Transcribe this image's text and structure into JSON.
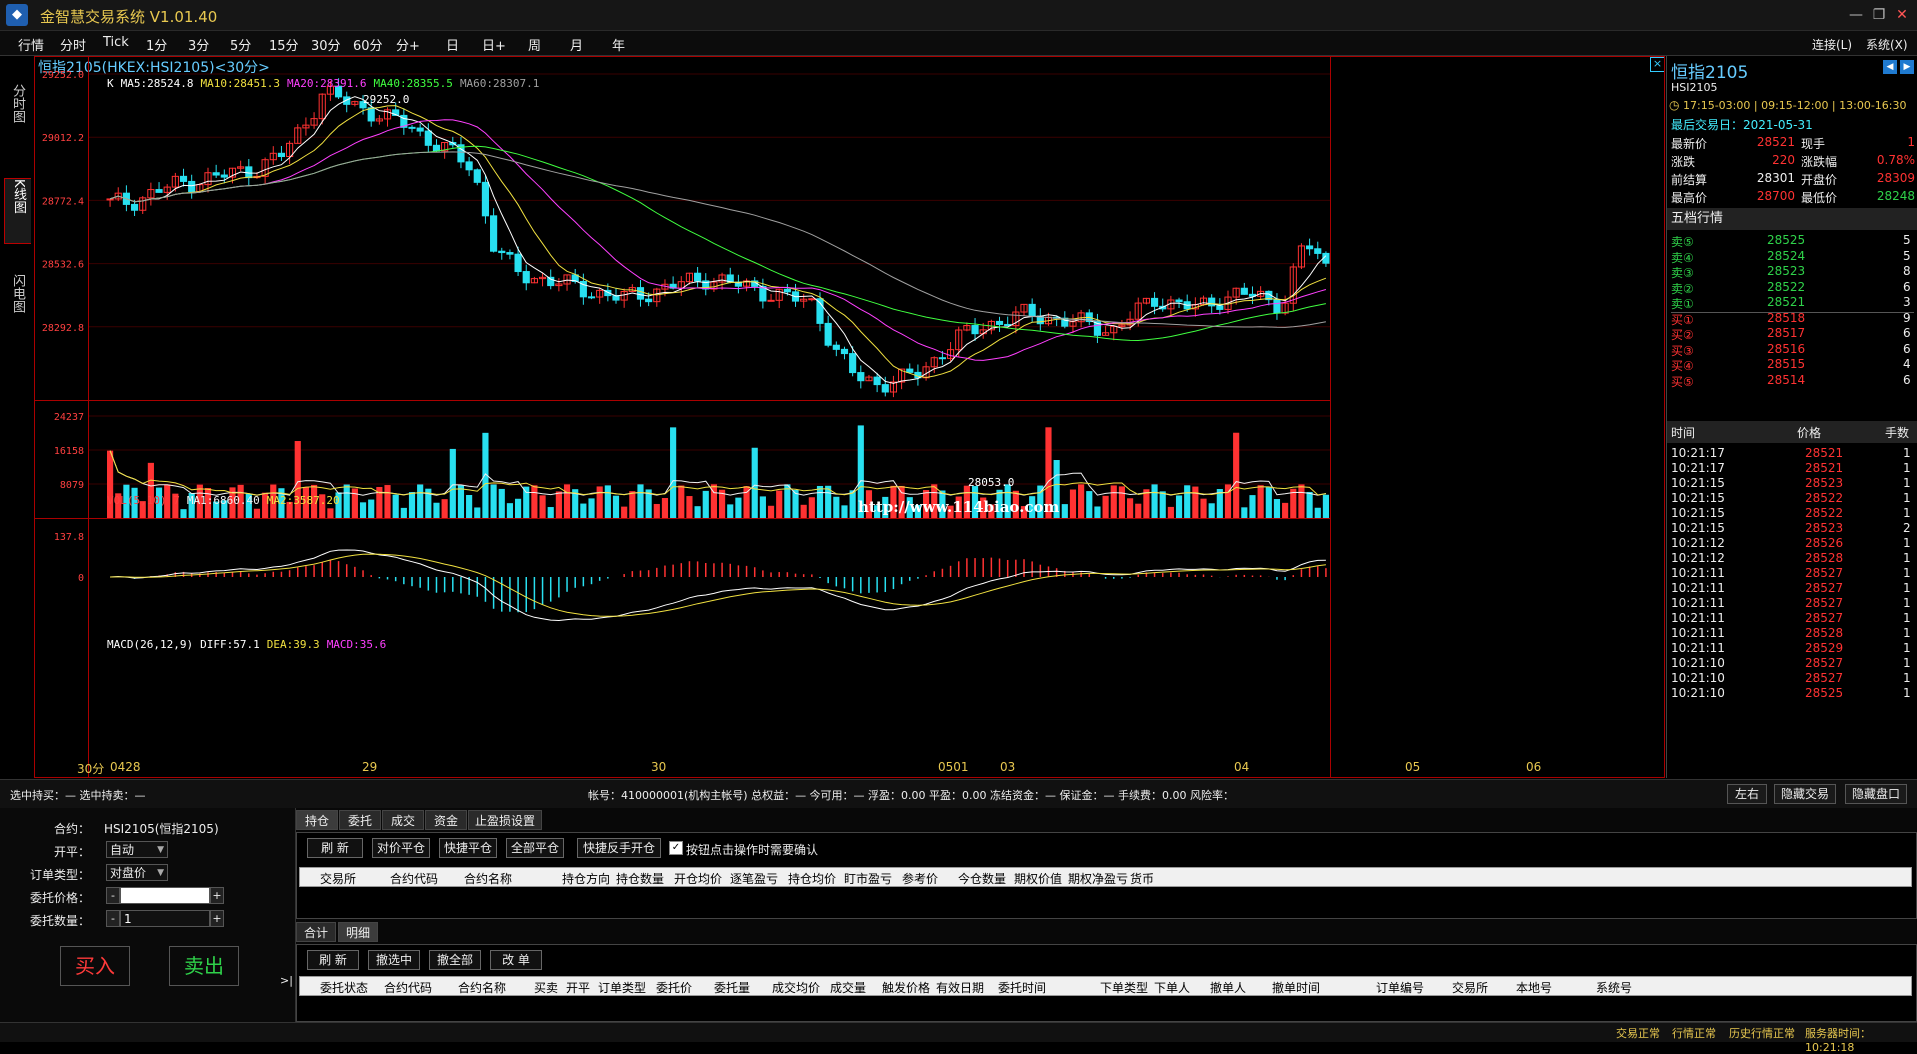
{
  "app": {
    "title": "金智慧交易系统  V1.01.40"
  },
  "menu": {
    "items": [
      "行情",
      "分时",
      "Tick",
      "1分",
      "3分",
      "5分",
      "15分",
      "30分",
      "60分",
      "分+",
      "日",
      "日+",
      "周",
      "月",
      "年"
    ],
    "right": [
      "连接(L)",
      "系统(X)"
    ]
  },
  "side_tabs": [
    "分时图",
    "K线图",
    "闪电图"
  ],
  "chart": {
    "title": "恒指2105(HKEX:HSI2105)<30分>",
    "main_ind": [
      {
        "text": "K",
        "color": "#ffffff"
      },
      {
        "text": "MA5:28524.8",
        "color": "#ffffff"
      },
      {
        "text": "MA10:28451.3",
        "color": "#f0e040"
      },
      {
        "text": "MA20:28391.6",
        "color": "#ff40ff"
      },
      {
        "text": "MA40:28355.5",
        "color": "#40ff40"
      },
      {
        "text": "MA60:28307.1",
        "color": "#a0a0a0"
      }
    ],
    "vol_ind": [
      {
        "text": "VOL(5,10)  7",
        "color": "#ff4040"
      },
      {
        "text": "MA1:6860.40",
        "color": "#f0f0f0"
      },
      {
        "text": "MA2:3587.20",
        "color": "#f0e040"
      }
    ],
    "macd_ind": [
      {
        "text": "MACD(26,12,9)",
        "color": "#ffffff"
      },
      {
        "text": "DIFF:57.1",
        "color": "#ffffff"
      },
      {
        "text": "DEA:39.3",
        "color": "#f0e040"
      },
      {
        "text": "MACD:35.6",
        "color": "#ff40ff"
      }
    ],
    "price_ticks": [
      "29252.0",
      "29012.2",
      "28772.4",
      "28532.6",
      "28292.8"
    ],
    "vol_ticks": [
      "24237",
      "16158",
      "8079"
    ],
    "macd_ticks": [
      "137.8",
      "0"
    ],
    "high_label": "29252.0",
    "low_label": "28053.0",
    "watermark": "http://www.114biao.com",
    "period_label": "30分",
    "x_labels": [
      "0428",
      "29",
      "30",
      "0501",
      "03",
      "04",
      "05",
      "06"
    ]
  },
  "chart_data": {
    "type": "candlestick",
    "symbol": "HSI2105",
    "period": "30分",
    "ylim": [
      28053,
      29252
    ],
    "ohlc_close_approx": [
      28760,
      28770,
      28800,
      28830,
      28850,
      28860,
      28880,
      28900,
      28940,
      29050,
      29180,
      29150,
      29120,
      29080,
      29060,
      29000,
      28950,
      28900,
      28600,
      28500,
      28480,
      28460,
      28440,
      28420,
      28400,
      28420,
      28440,
      28460,
      28480,
      28460,
      28440,
      28420,
      28400,
      28380,
      28200,
      28100,
      28080,
      28090,
      28120,
      28200,
      28260,
      28300,
      28320,
      28340,
      28330,
      28310,
      28300,
      28280,
      28340,
      28400,
      28380,
      28360,
      28400,
      28420,
      28400,
      28380,
      28620,
      28521
    ]
  },
  "quote": {
    "name": "恒指2105",
    "code": "HSI2105",
    "sessions": "17:15-03:00 | 09:15-12:00 | 13:00-16:30",
    "last_day": "最后交易日：2021-05-31",
    "rows": [
      {
        "l1": "最新价",
        "v1": "28521",
        "c1": "red",
        "l2": "现手",
        "v2": "1",
        "c2": "red"
      },
      {
        "l1": "涨跌",
        "v1": "220",
        "c1": "red",
        "l2": "涨跌幅",
        "v2": "0.78%",
        "c2": "red"
      },
      {
        "l1": "前结算",
        "v1": "28301",
        "c1": "white",
        "l2": "开盘价",
        "v2": "28309",
        "c2": "red"
      },
      {
        "l1": "最高价",
        "v1": "28700",
        "c1": "red",
        "l2": "最低价",
        "v2": "28248",
        "c2": "green"
      }
    ],
    "depth_title": "五档行情",
    "asks": [
      {
        "label": "卖⑤",
        "price": "28525",
        "vol": "5"
      },
      {
        "label": "卖④",
        "price": "28524",
        "vol": "5"
      },
      {
        "label": "卖③",
        "price": "28523",
        "vol": "8"
      },
      {
        "label": "卖②",
        "price": "28522",
        "vol": "6"
      },
      {
        "label": "卖①",
        "price": "28521",
        "vol": "3"
      }
    ],
    "bids": [
      {
        "label": "买①",
        "price": "28518",
        "vol": "9"
      },
      {
        "label": "买②",
        "price": "28517",
        "vol": "6"
      },
      {
        "label": "买③",
        "price": "28516",
        "vol": "6"
      },
      {
        "label": "买④",
        "price": "28515",
        "vol": "4"
      },
      {
        "label": "买⑤",
        "price": "28514",
        "vol": "6"
      }
    ],
    "ticks_header": {
      "time": "时间",
      "price": "价格",
      "vol": "手数"
    },
    "ticks": [
      {
        "t": "10:21:17",
        "p": "28521",
        "v": "1"
      },
      {
        "t": "10:21:17",
        "p": "28521",
        "v": "1"
      },
      {
        "t": "10:21:15",
        "p": "28523",
        "v": "1"
      },
      {
        "t": "10:21:15",
        "p": "28522",
        "v": "1"
      },
      {
        "t": "10:21:15",
        "p": "28522",
        "v": "1"
      },
      {
        "t": "10:21:15",
        "p": "28523",
        "v": "2"
      },
      {
        "t": "10:21:12",
        "p": "28526",
        "v": "1"
      },
      {
        "t": "10:21:12",
        "p": "28528",
        "v": "1"
      },
      {
        "t": "10:21:11",
        "p": "28527",
        "v": "1"
      },
      {
        "t": "10:21:11",
        "p": "28527",
        "v": "1"
      },
      {
        "t": "10:21:11",
        "p": "28527",
        "v": "1"
      },
      {
        "t": "10:21:11",
        "p": "28527",
        "v": "1"
      },
      {
        "t": "10:21:11",
        "p": "28528",
        "v": "1"
      },
      {
        "t": "10:21:11",
        "p": "28529",
        "v": "1"
      },
      {
        "t": "10:21:10",
        "p": "28527",
        "v": "1"
      },
      {
        "t": "10:21:10",
        "p": "28527",
        "v": "1"
      },
      {
        "t": "10:21:10",
        "p": "28525",
        "v": "1"
      }
    ]
  },
  "infobar": {
    "left": "选中持买：—   选中持卖：—",
    "account": "帐号：410000001(机构主帐号)  总权益：— 今可用：— 浮盈：0.00 平盈：0.00 冻结资金：— 保证金：— 手续费：0.00 风险率：",
    "btn_left_right": "左右",
    "btn_hide_trade": "隐藏交易",
    "btn_hide_quote": "隐藏盘口"
  },
  "order_form": {
    "contract_label": "合约：",
    "contract_value": "HSI2105(恒指2105)",
    "openclose_label": "开平：",
    "openclose_value": "自动",
    "ordertype_label": "订单类型：",
    "ordertype_value": "对盘价",
    "price_label": "委托价格：",
    "price_value": "",
    "qty_label": "委托数量：",
    "qty_value": "1",
    "buy": "买入",
    "sell": "卖出",
    "collapse": ">|"
  },
  "positions": {
    "tabs": [
      "持仓",
      "委托",
      "成交",
      "资金",
      "止盈损设置"
    ],
    "buttons": [
      "刷 新",
      "对价平仓",
      "快捷平仓",
      "全部平仓",
      "快捷反手开仓"
    ],
    "confirm_label": "按钮点击操作时需要确认",
    "columns": [
      "交易所",
      "合约代码",
      "合约名称",
      "持仓方向",
      "持仓数量",
      "开仓均价",
      "逐笔盈亏",
      "持仓均价",
      "盯市盈亏",
      "参考价",
      "今仓数量",
      "期权价值",
      "期权净盈亏",
      "货币"
    ]
  },
  "orders": {
    "tabs": [
      "合计",
      "明细"
    ],
    "buttons": [
      "刷 新",
      "撤选中",
      "撤全部",
      "改 单"
    ],
    "columns": [
      "委托状态",
      "合约代码",
      "合约名称",
      "买卖",
      "开平",
      "订单类型",
      "委托价",
      "委托量",
      "成交均价",
      "成交量",
      "触发价格",
      "有效日期",
      "委托时间",
      "下单类型",
      "下单人",
      "撤单人",
      "撤单时间",
      "订单编号",
      "交易所",
      "本地号",
      "系统号"
    ]
  },
  "status": [
    "交易正常",
    "行情正常",
    "历史行情正常",
    "服务器时间：10:21:18"
  ]
}
